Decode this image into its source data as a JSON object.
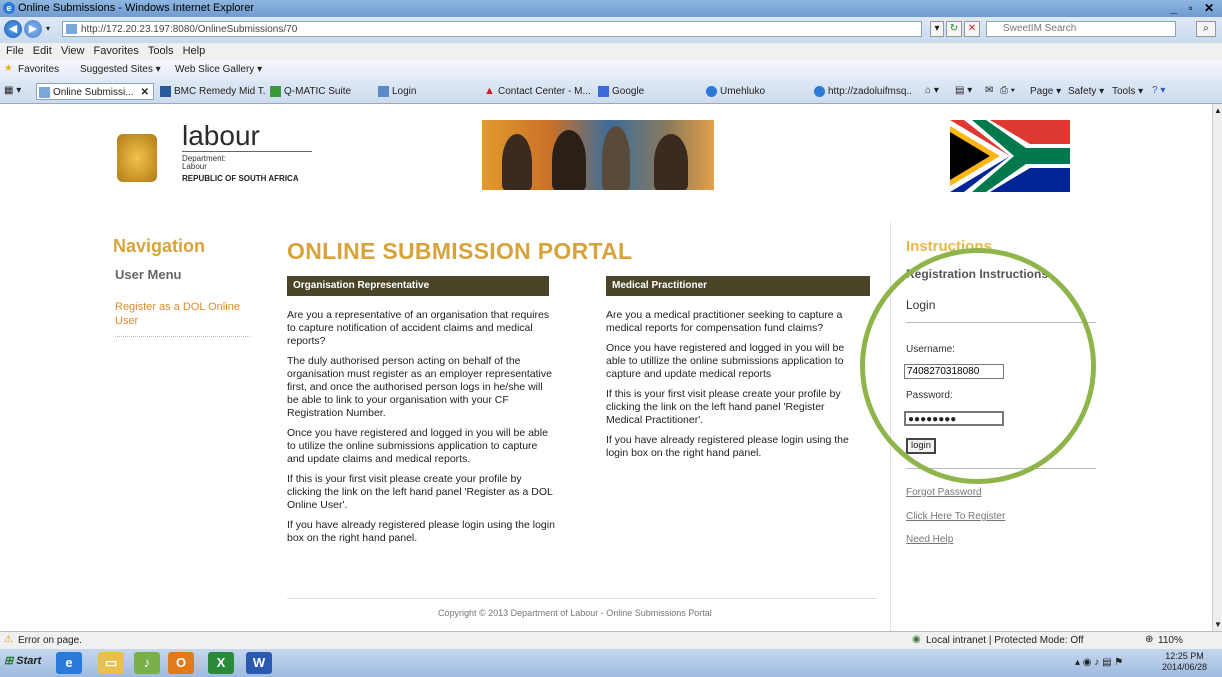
{
  "window": {
    "title": "Online Submissions - Windows Internet Explorer",
    "controls": "_ ▫ ✕"
  },
  "address": {
    "url": "http://172.20.23.197:8080/OnlineSubmissions/70",
    "search_placeholder": "SweetIM Search"
  },
  "menu": [
    "File",
    "Edit",
    "View",
    "Favorites",
    "Tools",
    "Help"
  ],
  "favorites": {
    "label": "Favorites",
    "items": [
      "Suggested Sites ▾",
      "Web Slice Gallery ▾"
    ]
  },
  "tabs": [
    {
      "label": "Online Submissi...",
      "active": true,
      "close": "✕"
    },
    {
      "label": "BMC Remedy Mid T..."
    },
    {
      "label": "Q-MATIC Suite"
    },
    {
      "label": "Login"
    },
    {
      "label": "Contact Center - M..."
    },
    {
      "label": "Google"
    },
    {
      "label": "Umehluko"
    },
    {
      "label": "http://zadoluifmsq..."
    }
  ],
  "toolbar_right": [
    "Page ▾",
    "Safety ▾",
    "Tools ▾"
  ],
  "logo": {
    "word": "labour",
    "dept_lines": [
      "Department:",
      "Labour"
    ],
    "country": "REPUBLIC OF SOUTH AFRICA"
  },
  "nav": {
    "heading": "Navigation",
    "user_menu": "User Menu",
    "register_link": "Register as a DOL Online User"
  },
  "portal": {
    "title": "ONLINE SUBMISSION PORTAL",
    "org": {
      "heading": "Organisation Representative",
      "paras": [
        "Are you a representative of an organisation that requires to capture notification of accident claims and medical reports?",
        "The duly authorised person acting on behalf of the organisation must register as an employer representative first, and once the authorised person logs in he/she will be able to link to your organisation with your CF Registration Number.",
        "Once you have registered and logged in you will be able to utilize the online submissions application to capture and update claims and medical reports.",
        "If this is your first visit please create your profile by clicking the link on the left hand panel 'Register as a DOL Online User'.",
        "If you have already registered please login using the login box on the right hand panel."
      ]
    },
    "med": {
      "heading": "Medical Practitioner",
      "paras": [
        "Are you a medical practitioner seeking to capture a medical reports for compensation fund claims?",
        "Once you have registered and logged in you will be able to utillize the online submissions application to capture and update medical reports",
        "If this is your first visit please create your profile by clicking the link on the left hand panel 'Register Medical Practitioner'.",
        "If you have already registered please login using the login box on the right hand panel."
      ]
    },
    "copyright": "Copyright © 2013 Department of Labour - Online Submissions Portal"
  },
  "instructions": {
    "heading": "Instructions",
    "reg": "Registration Instructions",
    "login_heading": "Login",
    "username_label": "Username:",
    "username_value": "7408270318080",
    "password_label": "Password:",
    "password_value": "●●●●●●●●",
    "login_button": "login",
    "links": [
      "Forgot Password",
      "Click Here To Register",
      "Need Help"
    ]
  },
  "status": {
    "left": "Error on page.",
    "zone": "Local intranet | Protected Mode: Off",
    "zoom": "110%"
  },
  "taskbar": {
    "start": "Start",
    "time": "12:25 PM",
    "date": "2014/06/28"
  },
  "colors": {
    "accent": "#d9a33b",
    "header_bar": "#4a4428",
    "highlight_circle": "#8fb54a"
  }
}
